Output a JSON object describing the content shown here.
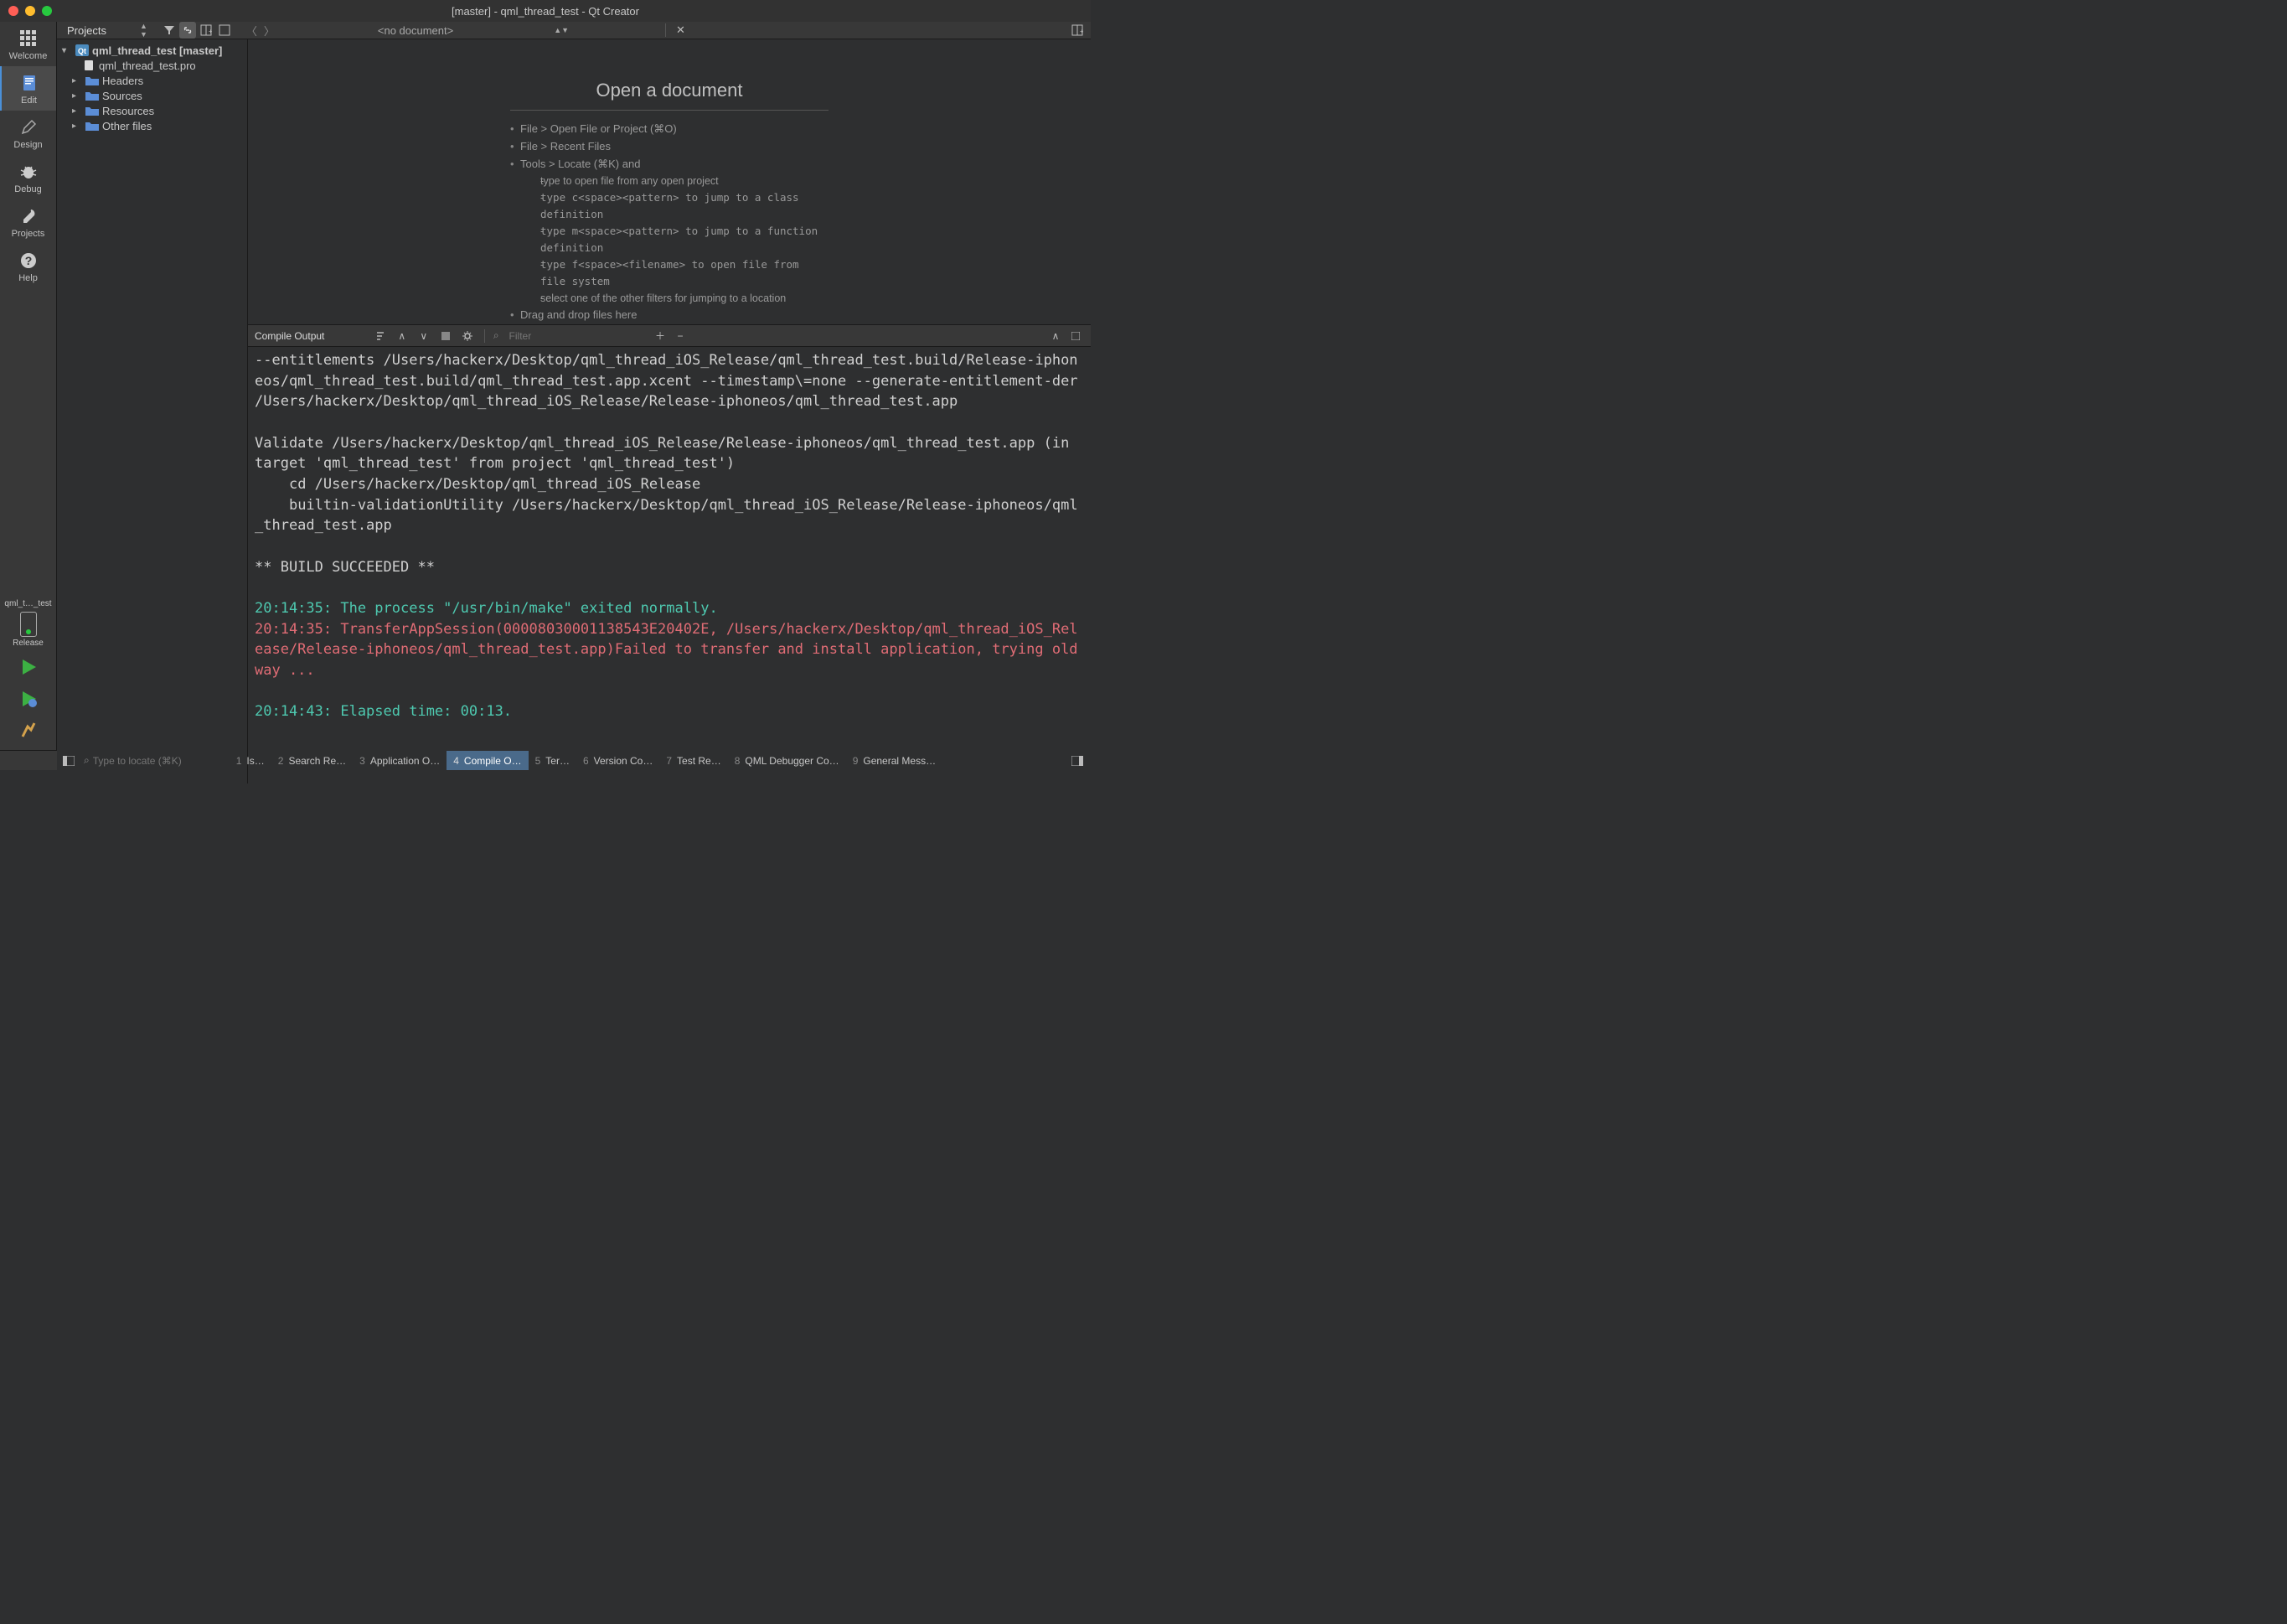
{
  "window": {
    "title": "[master] - qml_thread_test - Qt Creator"
  },
  "leftbar": {
    "items": [
      {
        "label": "Welcome",
        "icon": "grid"
      },
      {
        "label": "Edit",
        "icon": "edit"
      },
      {
        "label": "Design",
        "icon": "pencil"
      },
      {
        "label": "Debug",
        "icon": "bug"
      },
      {
        "label": "Projects",
        "icon": "wrench"
      },
      {
        "label": "Help",
        "icon": "question"
      }
    ],
    "kit": {
      "top": "qml_t…_test",
      "mode": "Release"
    }
  },
  "toolbar": {
    "projects_label": "Projects",
    "no_document": "<no document>"
  },
  "tree": {
    "root": "qml_thread_test [master]",
    "pro_file": "qml_thread_test.pro",
    "folders": [
      "Headers",
      "Sources",
      "Resources",
      "Other files"
    ]
  },
  "placeholder": {
    "title": "Open a document",
    "items": [
      "File > Open File or Project (⌘O)",
      "File > Recent Files",
      "Tools > Locate (⌘K) and"
    ],
    "sub": [
      "type to open file from any open project",
      "type c<space><pattern> to jump to a class definition",
      "type m<space><pattern> to jump to a function definition",
      "type f<space><filename> to open file from file system",
      "select one of the other filters for jumping to a location"
    ],
    "drag": "Drag and drop files here"
  },
  "output": {
    "title": "Compile Output",
    "filter_placeholder": "Filter",
    "lines": [
      {
        "cls": "",
        "text": "--entitlements /Users/hackerx/Desktop/qml_thread_iOS_Release/qml_thread_test.build/Release-iphoneos/qml_thread_test.build/qml_thread_test.app.xcent --timestamp\\=none --generate-entitlement-der /Users/hackerx/Desktop/qml_thread_iOS_Release/Release-iphoneos/qml_thread_test.app"
      },
      {
        "cls": "",
        "text": ""
      },
      {
        "cls": "",
        "text": "Validate /Users/hackerx/Desktop/qml_thread_iOS_Release/Release-iphoneos/qml_thread_test.app (in target 'qml_thread_test' from project 'qml_thread_test')"
      },
      {
        "cls": "",
        "text": "    cd /Users/hackerx/Desktop/qml_thread_iOS_Release"
      },
      {
        "cls": "",
        "text": "    builtin-validationUtility /Users/hackerx/Desktop/qml_thread_iOS_Release/Release-iphoneos/qml_thread_test.app"
      },
      {
        "cls": "",
        "text": ""
      },
      {
        "cls": "",
        "text": "** BUILD SUCCEEDED **"
      },
      {
        "cls": "",
        "text": ""
      },
      {
        "cls": "teal",
        "text": "20:14:35: The process \"/usr/bin/make\" exited normally."
      },
      {
        "cls": "red",
        "text": "20:14:35: TransferAppSession(00008030001138543E20402E, /Users/hackerx/Desktop/qml_thread_iOS_Release/Release-iphoneos/qml_thread_test.app)Failed to transfer and install application, trying old way ..."
      },
      {
        "cls": "",
        "text": ""
      },
      {
        "cls": "teal",
        "text": "20:14:43: Elapsed time: 00:13."
      }
    ]
  },
  "status": {
    "locator_placeholder": "Type to locate (⌘K)",
    "tabs": [
      {
        "n": "1",
        "label": "Is…"
      },
      {
        "n": "2",
        "label": "Search Re…"
      },
      {
        "n": "3",
        "label": "Application O…"
      },
      {
        "n": "4",
        "label": "Compile O…"
      },
      {
        "n": "5",
        "label": "Ter…"
      },
      {
        "n": "6",
        "label": "Version Co…"
      },
      {
        "n": "7",
        "label": "Test Re…"
      },
      {
        "n": "8",
        "label": "QML Debugger Co…"
      },
      {
        "n": "9",
        "label": "General Mess…"
      }
    ]
  }
}
